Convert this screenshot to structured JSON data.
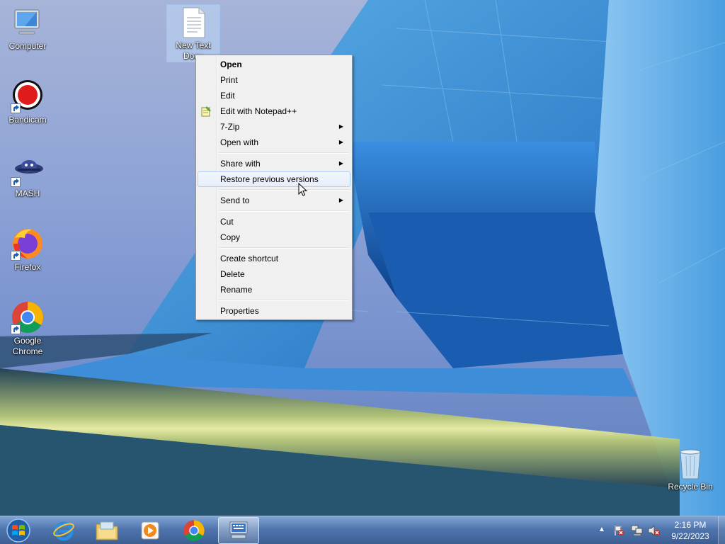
{
  "desktop": {
    "icons": [
      {
        "label": "Computer",
        "glyph": "computer-icon"
      },
      {
        "label": "Bandicam",
        "glyph": "bandicam-icon"
      },
      {
        "label": "MASH",
        "glyph": "mash-icon"
      },
      {
        "label": "Firefox",
        "glyph": "firefox-icon"
      },
      {
        "label": "Google Chrome",
        "glyph": "chrome-icon"
      },
      {
        "label": "New Text Docu",
        "glyph": "text-document-icon"
      },
      {
        "label": "Recycle Bin",
        "glyph": "recycle-bin-icon"
      }
    ]
  },
  "context_menu": {
    "items": [
      {
        "label": "Open"
      },
      {
        "label": "Print"
      },
      {
        "label": "Edit"
      },
      {
        "label": "Edit with Notepad++",
        "icon": "notepad-plus-plus-icon"
      },
      {
        "label": "7-Zip",
        "submenu": true
      },
      {
        "label": "Open with",
        "submenu": true
      },
      {
        "label": "Share with",
        "submenu": true
      },
      {
        "label": "Restore previous versions"
      },
      {
        "label": "Send to",
        "submenu": true
      },
      {
        "label": "Cut"
      },
      {
        "label": "Copy"
      },
      {
        "label": "Create shortcut"
      },
      {
        "label": "Delete"
      },
      {
        "label": "Rename"
      },
      {
        "label": "Properties"
      }
    ],
    "highlighted": "Restore previous versions",
    "submenu_arrow": "▶"
  },
  "taskbar": {
    "pinned": [
      "start-orb-icon",
      "internet-explorer-icon",
      "file-explorer-icon",
      "media-player-icon",
      "chrome-icon",
      "on-screen-keyboard-icon"
    ],
    "tray": {
      "expand_arrow": "▲",
      "icons": [
        "action-center-icon",
        "network-icon",
        "volume-muted-icon"
      ],
      "time": "2:16 PM",
      "date": "9/22/2023"
    }
  },
  "colors": {
    "menu_background": "#f0f0f0",
    "menu_highlight_border": "#aecff7",
    "taskbar": "#466ea8"
  }
}
